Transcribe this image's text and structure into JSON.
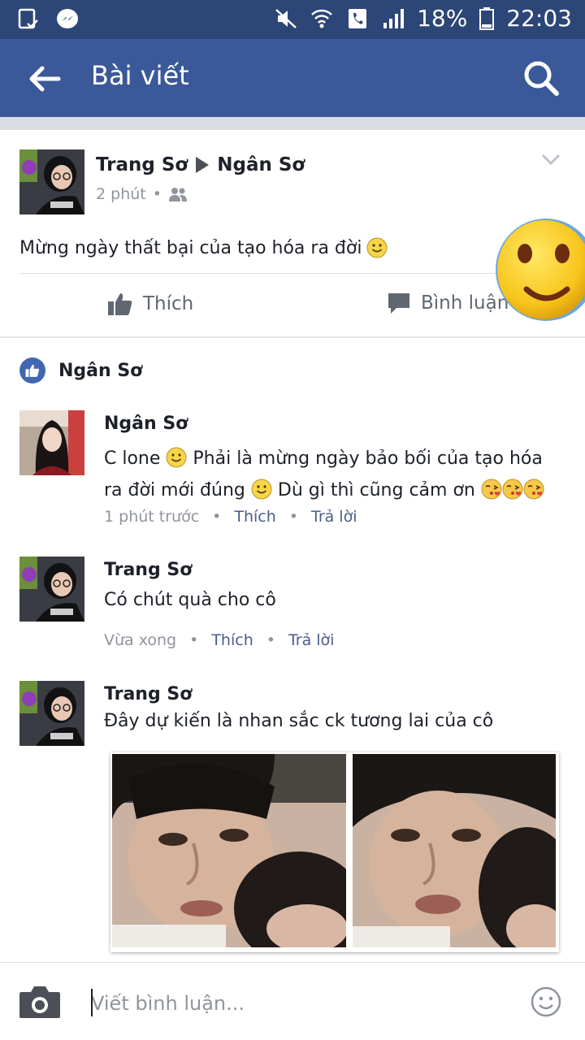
{
  "status_bar": {
    "battery": "18%",
    "time": "22:03"
  },
  "header": {
    "title": "Bài viết"
  },
  "post": {
    "author": "Trang Sơ",
    "recipient": "Ngân Sơ",
    "time": "2 phút",
    "separator": "•",
    "text": "Mừng ngày thất bại của tạo hóa ra đời",
    "like_label": "Thích",
    "comment_label": "Bình luận"
  },
  "likes": {
    "names": "Ngân Sơ"
  },
  "comments": [
    {
      "name": "Ngân Sơ",
      "line1": "C lone",
      "line1b": "Phải là mừng ngày bảo bối của tạo hóa",
      "line2": "ra đời mới đúng",
      "line2b": "Dù gì thì cũng cảm ơn",
      "time": "1 phút trước",
      "like": "Thích",
      "reply": "Trả lời"
    },
    {
      "name": "Trang Sơ",
      "text": "Có chút quà cho cô",
      "time": "Vừa xong",
      "like": "Thích",
      "reply": "Trả lời"
    },
    {
      "name": "Trang Sơ",
      "text": "Đây dự kiến là nhan sắc ck tương lai của cô"
    }
  ],
  "composer": {
    "placeholder": "Viết bình luận..."
  },
  "colors": {
    "brand": "#3b5998",
    "statusbar": "#2c4677",
    "link": "#4b5d86",
    "muted": "#90949c"
  }
}
